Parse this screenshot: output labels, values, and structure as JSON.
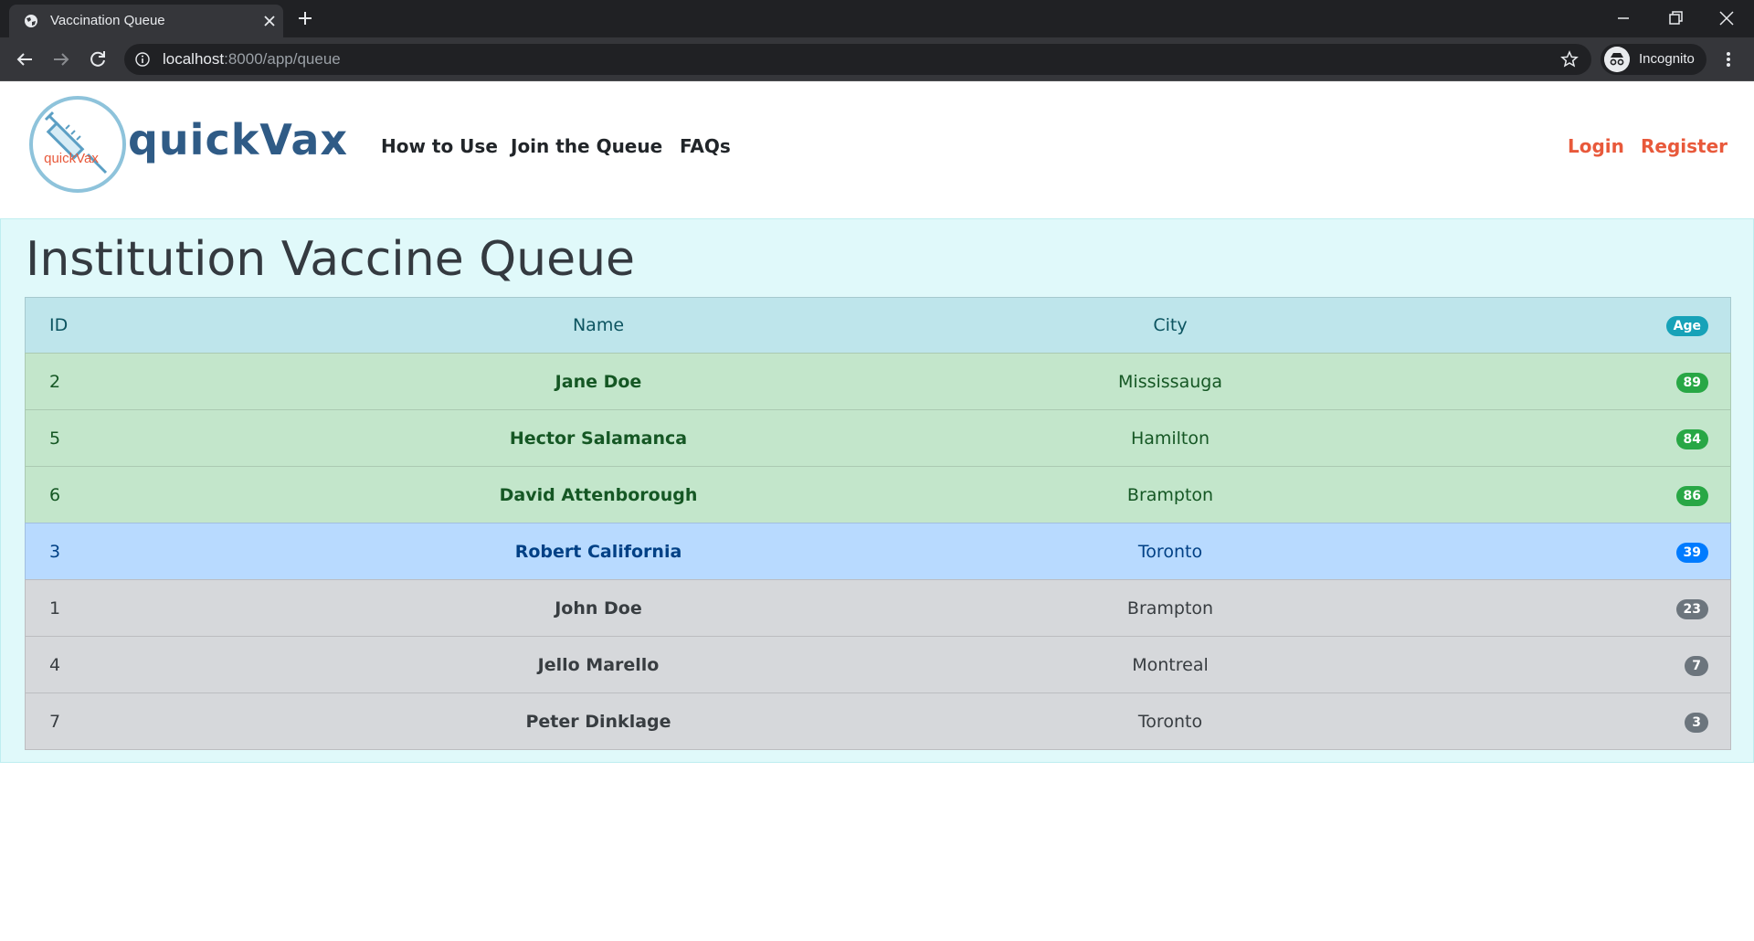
{
  "browser": {
    "tab_title": "Vaccination Queue",
    "url_host": "localhost",
    "url_path": ":8000/app/queue",
    "incognito_label": "Incognito"
  },
  "site": {
    "brand": "quickVax",
    "logo_text": "quickVax",
    "nav": [
      "How to Use",
      "Join the Queue",
      "FAQs"
    ],
    "login": "Login",
    "register": "Register",
    "accent_color": "#e8593b",
    "brand_color": "#2f5b86"
  },
  "main": {
    "title": "Institution Vaccine Queue",
    "columns": {
      "id": "ID",
      "name": "Name",
      "city": "City",
      "age": "Age"
    },
    "rows": [
      {
        "id": "2",
        "name": "Jane Doe",
        "city": "Mississauga",
        "age": "89",
        "status": "success"
      },
      {
        "id": "5",
        "name": "Hector Salamanca",
        "city": "Hamilton",
        "age": "84",
        "status": "success"
      },
      {
        "id": "6",
        "name": "David Attenborough",
        "city": "Brampton",
        "age": "86",
        "status": "success"
      },
      {
        "id": "3",
        "name": "Robert California",
        "city": "Toronto",
        "age": "39",
        "status": "primary"
      },
      {
        "id": "1",
        "name": "John Doe",
        "city": "Brampton",
        "age": "23",
        "status": "secondary"
      },
      {
        "id": "4",
        "name": "Jello Marello",
        "city": "Montreal",
        "age": "7",
        "status": "secondary"
      },
      {
        "id": "7",
        "name": "Peter Dinklage",
        "city": "Toronto",
        "age": "3",
        "status": "secondary"
      }
    ]
  }
}
